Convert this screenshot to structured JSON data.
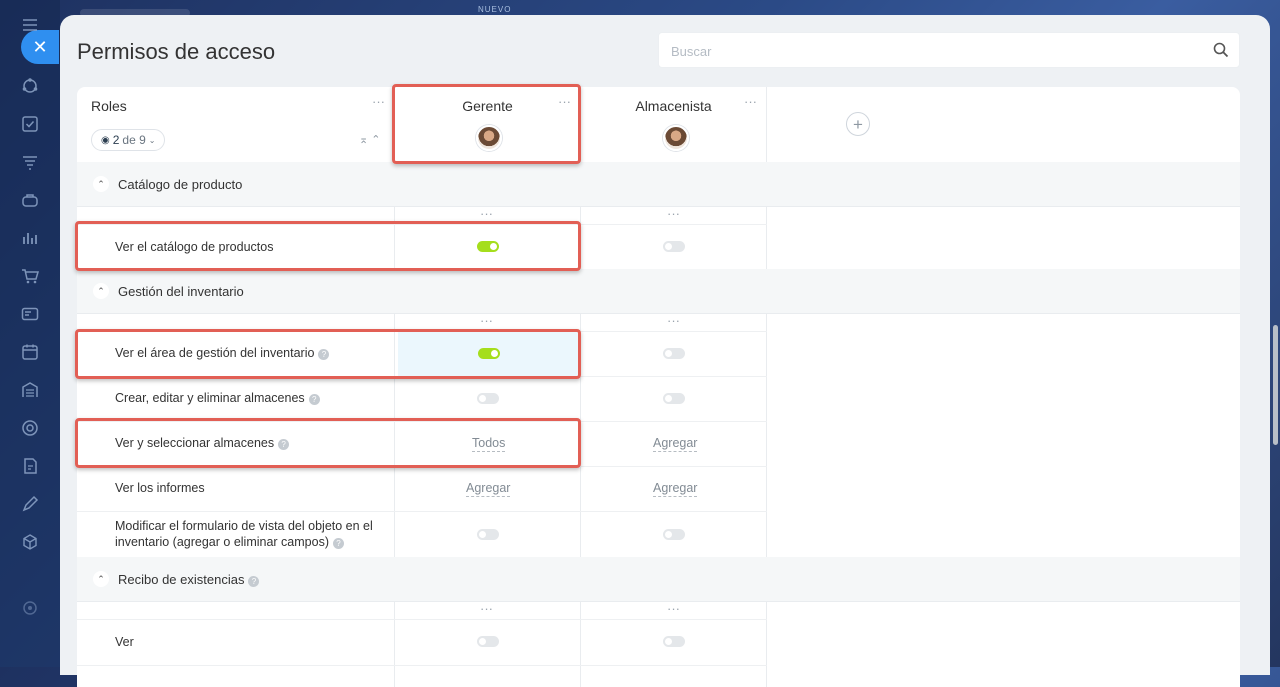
{
  "background": {
    "top_label": "NUEVO"
  },
  "panel": {
    "title": "Permisos de acceso",
    "search_placeholder": "Buscar"
  },
  "roles_header": {
    "label": "Roles",
    "counter_value": "2",
    "counter_of": "de 9",
    "dots": "···"
  },
  "roles": [
    {
      "name": "Gerente"
    },
    {
      "name": "Almacenista"
    }
  ],
  "add_role_symbol": "+",
  "sections": [
    {
      "title": "Catálogo de producto"
    },
    {
      "title": "Gestión del inventario"
    },
    {
      "title": "Recibo de existencias"
    }
  ],
  "permissions": {
    "catalog_view": {
      "label": "Ver el catálogo de productos",
      "gerente": "on",
      "almacenista": "off"
    },
    "inventory_area": {
      "label": "Ver el área de gestión del inventario",
      "gerente": "on",
      "almacenista": "off"
    },
    "warehouses_crud": {
      "label": "Crear, editar y eliminar almacenes",
      "gerente": "off",
      "almacenista": "off"
    },
    "warehouses_select": {
      "label": "Ver y seleccionar almacenes",
      "gerente": "Todos",
      "almacenista": "Agregar"
    },
    "reports": {
      "label": "Ver los informes",
      "gerente": "Agregar",
      "almacenista": "Agregar"
    },
    "form_edit": {
      "label": "Modificar el formulario de vista del objeto en el inventario (agregar o eliminar campos)",
      "gerente": "off",
      "almacenista": "off"
    },
    "receipt_view": {
      "label": "Ver",
      "gerente": "off",
      "almacenista": "off"
    }
  },
  "colors": {
    "toggle_on": "#a5de1c",
    "highlight_box": "#e25f55",
    "accent": "#2f8ff0"
  }
}
